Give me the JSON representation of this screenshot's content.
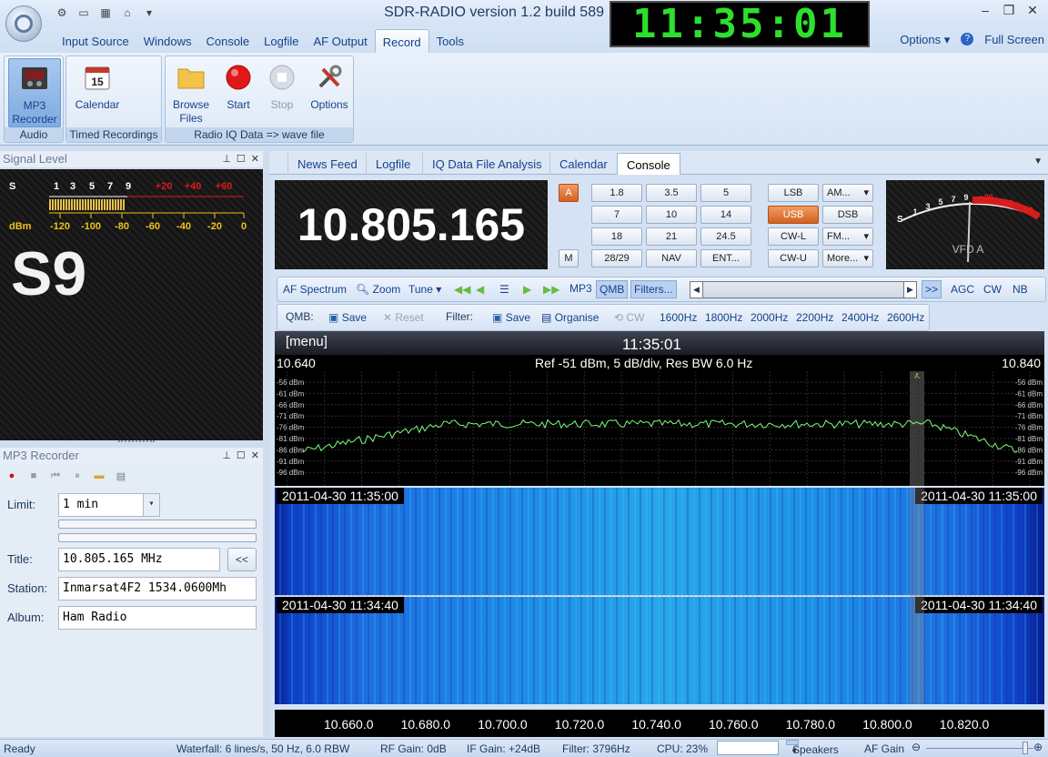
{
  "window": {
    "title": "SDR-RADIO version 1.2  build 589",
    "clock": "11:35:01"
  },
  "ribbon_tabs": [
    "Input Source",
    "Windows",
    "Console",
    "Logfile",
    "AF Output",
    "Record",
    "Tools"
  ],
  "ribbon_right": {
    "options": "Options",
    "fullscreen": "Full Screen"
  },
  "ribbon": {
    "mp3_recorder": "MP3 Recorder",
    "calendar": "Calendar",
    "browse_files": "Browse Files",
    "start": "Start",
    "stop": "Stop",
    "options": "Options",
    "group_audio": "Audio",
    "group_timed": "Timed Recordings",
    "group_iq": "Radio IQ Data => wave file"
  },
  "signal_panel": {
    "title": "Signal Level",
    "s_label": "S",
    "dbm_label": "dBm",
    "s_ticks": [
      "1",
      "3",
      "5",
      "7",
      "9",
      "+20",
      "+40",
      "+60"
    ],
    "dbm_ticks": [
      "-120",
      "-100",
      "-80",
      "-60",
      "-40",
      "-20",
      "0"
    ],
    "reading": "S9"
  },
  "mp3_panel": {
    "title": "MP3 Recorder",
    "limit_label": "Limit:",
    "limit_value": "1 min",
    "title_label": "Title:",
    "title_value": "10.805.165 MHz",
    "back_button": "<<",
    "station_label": "Station:",
    "station_value": "Inmarsat4F2 1534.0600Mh",
    "album_label": "Album:",
    "album_value": "Ham Radio"
  },
  "doc_tabs": [
    "News Feed",
    "Logfile",
    "IQ Data File Analysis",
    "Calendar",
    "Console"
  ],
  "console": {
    "frequency": "10.805.165",
    "vfo_button": "A",
    "mem_button": "M",
    "band_buttons": [
      "1.8",
      "3.5",
      "5",
      "7",
      "10",
      "14",
      "18",
      "21",
      "24.5",
      "28/29",
      "NAV",
      "ENT..."
    ],
    "mode_buttons": [
      "LSB",
      "AM...",
      "USB",
      "DSB",
      "CW-L",
      "FM...",
      "CW-U",
      "More..."
    ],
    "vfd_label": "VFD A",
    "vfd_ticks": [
      "1",
      "3",
      "5",
      "7",
      "9",
      "+20",
      "+40",
      "+60"
    ],
    "vfd_s": "S",
    "toolbar": {
      "af_spectrum": "AF Spectrum",
      "zoom": "Zoom",
      "tune": "Tune",
      "mp3": "MP3",
      "qmb": "QMB",
      "filters": "Filters...",
      "more": ">>",
      "agc": "AGC",
      "cw": "CW",
      "nb": "NB"
    },
    "qmb_bar": {
      "qmb_label": "QMB:",
      "save": "Save",
      "reset": "Reset",
      "filter_label": "Filter:",
      "save2": "Save",
      "organise": "Organise",
      "cw": "CW",
      "filters": [
        "1600Hz",
        "1800Hz",
        "2000Hz",
        "2200Hz",
        "2400Hz",
        "2600Hz"
      ]
    },
    "spectrum": {
      "menu": "[menu]",
      "time": "11:35:01",
      "left_freq": "10.640",
      "right_freq": "10.840",
      "ref_info": "Ref -51 dBm,  5 dB/div,  Res BW 6.0 Hz",
      "db_labels": [
        "-56 dBm",
        "-61 dBm",
        "-66 dBm",
        "-71 dBm",
        "-76 dBm",
        "-81 dBm",
        "-86 dBm",
        "-91 dBm",
        "-96 dBm"
      ],
      "marker": "A"
    },
    "waterfall": {
      "stamp1": "2011-04-30   11:35:00",
      "stamp2": "2011-04-30   11:34:40"
    },
    "axis_labels": [
      "10.660.0",
      "10.680.0",
      "10.700.0",
      "10.720.0",
      "10.740.0",
      "10.760.0",
      "10.780.0",
      "10.800.0",
      "10.820.0"
    ]
  },
  "status": {
    "ready": "Ready",
    "waterfall": "Waterfall: 6 lines/s, 50 Hz, 6.0 RBW",
    "rf_gain": "RF Gain: 0dB",
    "if_gain": "IF Gain: +24dB",
    "filter": "Filter: 3796Hz",
    "cpu": "CPU: 23%",
    "speakers": "Speakers",
    "af_gain": "AF Gain"
  },
  "colors": {
    "clock_digits": "#2de02d",
    "spectrum_trace": "#7cff7c",
    "record_red": "#e01818",
    "active_orange": "#d4611f"
  }
}
